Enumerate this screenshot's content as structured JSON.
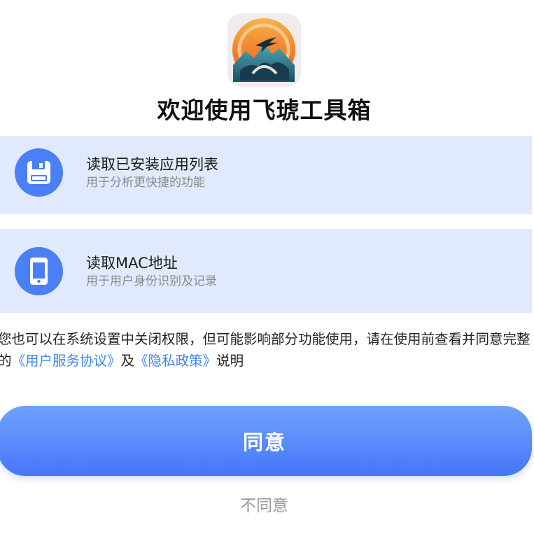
{
  "app": {
    "logo": "bird-mountain-sunset-logo",
    "title": "欢迎使用飞琥工具箱"
  },
  "permissions": [
    {
      "icon": "floppy-disk-icon",
      "title": "读取已安装应用列表",
      "description": "用于分析更快捷的功能"
    },
    {
      "icon": "smartphone-icon",
      "title": "读取MAC地址",
      "description": "用于用户身份识别及记录"
    }
  ],
  "notice": {
    "text_before": "您也可以在系统设置中关闭权限，但可能影响部分功能使用，请在使用前查看并同意完整的",
    "user_agreement_link": "《用户服务协议》",
    "conjunction": "及",
    "privacy_policy_link": "《隐私政策》",
    "text_after": "说明"
  },
  "actions": {
    "agree_label": "同意",
    "disagree_label": "不同意"
  },
  "colors": {
    "accent": "#4a7ff6",
    "card_background": "#e1eafc",
    "link": "#3f86ee",
    "button_gradient_top": "#6fa2fd",
    "button_gradient_bottom": "#4676f8",
    "muted_text": "#9a9a9a"
  }
}
